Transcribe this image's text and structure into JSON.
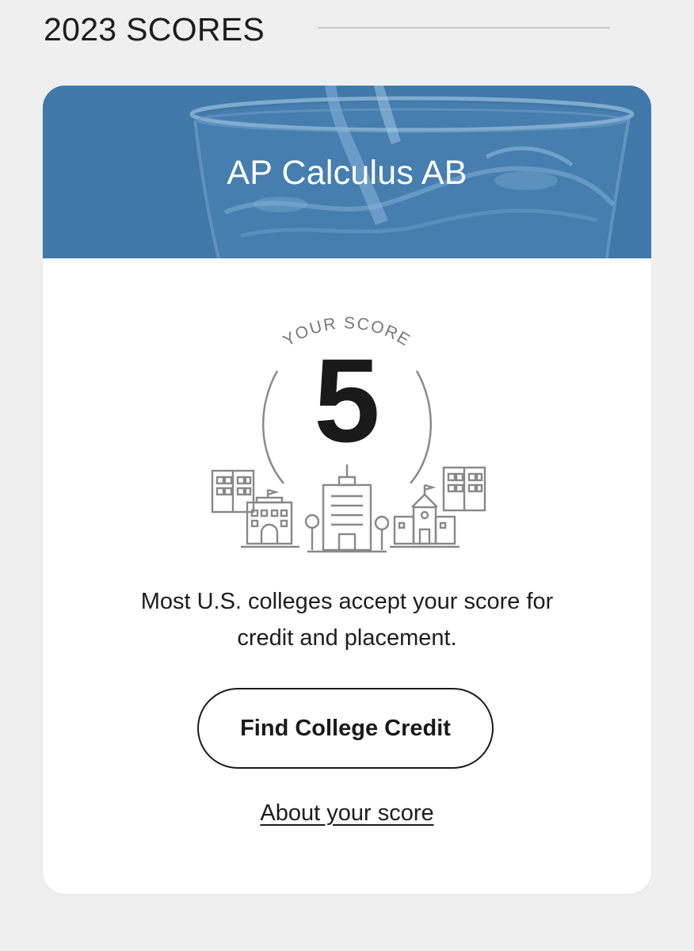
{
  "section": {
    "title": "2023 SCORES"
  },
  "card": {
    "course_title": "AP Calculus AB",
    "banner_color": "#3f78a9",
    "banner_image": "water-glass",
    "score_label": "YOUR SCORE",
    "score_value": "5",
    "illustration": "college-buildings",
    "message": "Most U.S. colleges accept your score for credit and placement.",
    "primary_button": "Find College Credit",
    "link": "About your score"
  }
}
